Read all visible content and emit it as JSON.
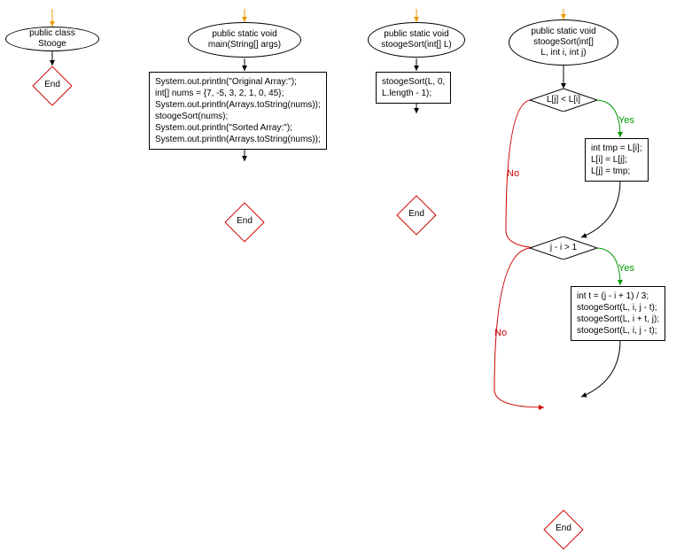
{
  "col1": {
    "ellipse": "public class Stooge"
  },
  "col2": {
    "ellipse": "public static void\nmain(String[] args)",
    "box": "System.out.println(\"Original Array:\");\nint[] nums = {7, -5, 3, 2, 1, 0, 45};\nSystem.out.println(Arrays.toString(nums));\nstoogeSort(nums);\nSystem.out.println(\"Sorted Array:\");\nSystem.out.println(Arrays.toString(nums));"
  },
  "col3": {
    "ellipse": "public static void\nstoogeSort(int[] L)",
    "box": "stoogeSort(L, 0,\nL.length - 1);"
  },
  "col4": {
    "ellipse": "public static void\nstoogeSort(int[]\nL, int i, int j)",
    "cond1": "L[j] < L[i]",
    "box1": "int tmp = L[i];\nL[i] = L[j];\nL[j] = tmp;",
    "cond2": "j - i > 1",
    "box2": "int t = (j - i + 1) / 3;\nstoogeSort(L, i, j - t);\nstoogeSort(L, i + t, j);\nstoogeSort(L, i, j - t);"
  },
  "labels": {
    "yes": "Yes",
    "no": "No",
    "end": "End"
  }
}
